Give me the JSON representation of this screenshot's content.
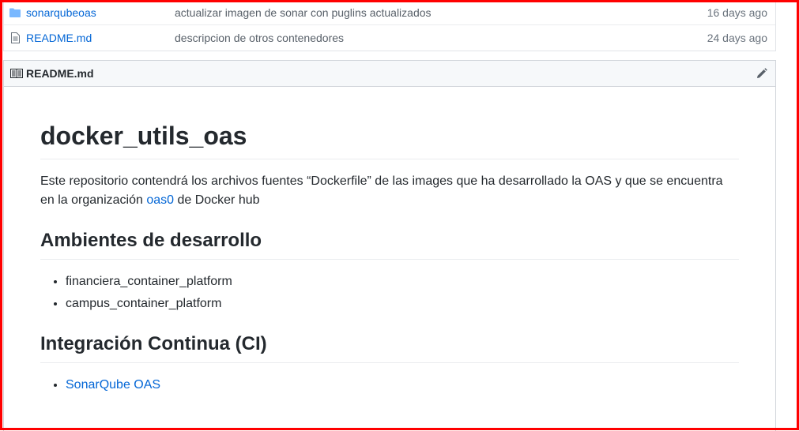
{
  "files": [
    {
      "icon": "folder-icon",
      "name": "sonarqubeoas",
      "message": "actualizar imagen de sonar con puglins actualizados",
      "age": "16 days ago"
    },
    {
      "icon": "file-icon",
      "name": "README.md",
      "message": "descripcion de otros contenedores",
      "age": "24 days ago"
    }
  ],
  "readme": {
    "header_title": "README.md",
    "edit_icon": "pencil-icon",
    "h1": "docker_utils_oas",
    "intro_before": "Este repositorio contendrá los archivos fuentes “Dockerfile” de las images que ha desarrollado la OAS y que se encuentra en la organización ",
    "intro_link": "oas0",
    "intro_after": " de Docker hub",
    "section1_title": "Ambientes de desarrollo",
    "section1_items": [
      "financiera_container_platform",
      "campus_container_platform"
    ],
    "section2_title": "Integración Continua (CI)",
    "section2_items": [
      "SonarQube OAS"
    ]
  },
  "colors": {
    "link": "#0366d6",
    "frame": "#ff0000"
  }
}
